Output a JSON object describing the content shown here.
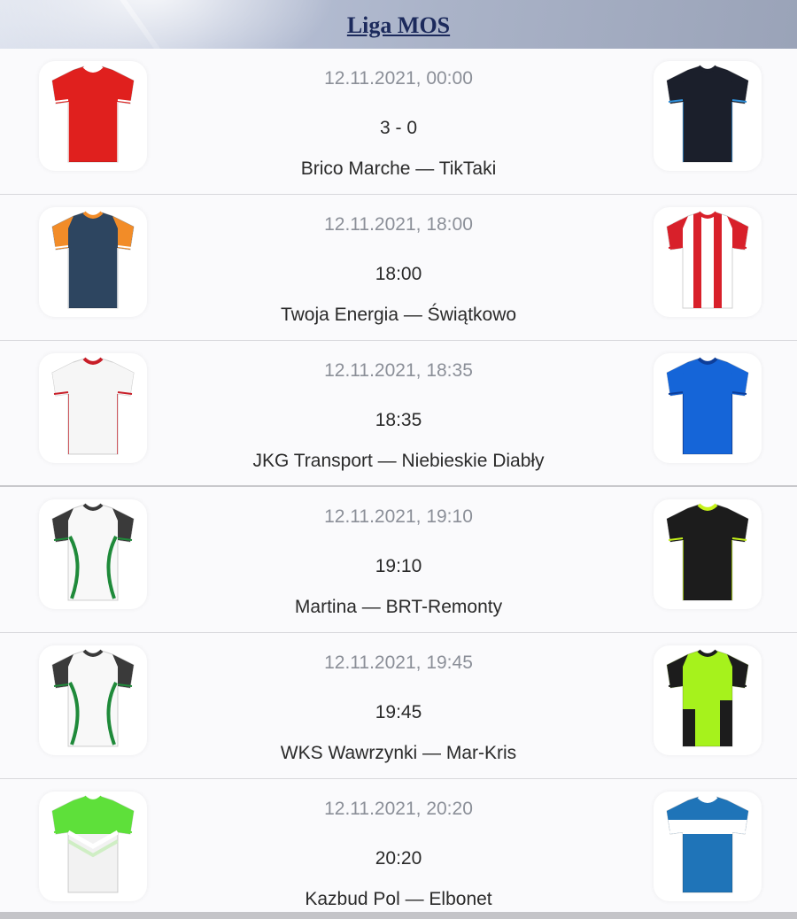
{
  "header": {
    "title": "Liga MOS"
  },
  "matches": [
    {
      "date": "12.11.2021, 00:00",
      "result": "3 - 0",
      "teams": "Brico Marche — TikTaki",
      "home_kit": {
        "type": "plain",
        "body": "#e0201e",
        "sleeve": "#e0201e",
        "collar": "#ffffff",
        "accent": "#ffffff"
      },
      "away_kit": {
        "type": "plain",
        "body": "#1b1f2b",
        "sleeve": "#1b1f2b",
        "collar": "#1b1f2b",
        "accent": "#2f8fd8"
      }
    },
    {
      "date": "12.11.2021, 18:00",
      "result": "18:00",
      "teams": "Twoja Energia — Świątkowo",
      "home_kit": {
        "type": "plain",
        "body": "#2d4560",
        "sleeve": "#f28c28",
        "collar": "#f28c28",
        "accent": "#ffffff"
      },
      "away_kit": {
        "type": "stripes",
        "body": "#ffffff",
        "sleeve": "#d8202a",
        "collar": "#d8202a",
        "accent": "#d8202a"
      }
    },
    {
      "date": "12.11.2021, 18:35",
      "result": "18:35",
      "teams": "JKG Transport — Niebieskie Diabły",
      "home_kit": {
        "type": "plain",
        "body": "#f6f6f6",
        "sleeve": "#f6f6f6",
        "collar": "#c81e28",
        "accent": "#c81e28"
      },
      "away_kit": {
        "type": "plain",
        "body": "#1565d8",
        "sleeve": "#1565d8",
        "collar": "#0d3e9a",
        "accent": "#0d3e9a"
      }
    },
    {
      "date": "12.11.2021, 19:10",
      "result": "19:10",
      "teams": "Martina — BRT-Remonty",
      "home_kit": {
        "type": "curves",
        "body": "#f8f8f8",
        "sleeve": "#3a3a3a",
        "collar": "#3a3a3a",
        "accent": "#1f8a3a"
      },
      "away_kit": {
        "type": "plain",
        "body": "#1c1c1c",
        "sleeve": "#1c1c1c",
        "collar": "#c6f21a",
        "accent": "#c6f21a"
      }
    },
    {
      "date": "12.11.2021, 19:45",
      "result": "19:45",
      "teams": "WKS Wawrzynki — Mar-Kris",
      "home_kit": {
        "type": "curves",
        "body": "#f8f8f8",
        "sleeve": "#3a3a3a",
        "collar": "#3a3a3a",
        "accent": "#1f8a3a"
      },
      "away_kit": {
        "type": "neonsplit",
        "body": "#a6f21c",
        "sleeve": "#1c1c1c",
        "collar": "#1c1c1c",
        "accent": "#1c1c1c"
      }
    },
    {
      "date": "12.11.2021, 20:20",
      "result": "20:20",
      "teams": "Kazbud Pol — Elbonet",
      "home_kit": {
        "type": "chevron",
        "body": "#f2f2f2",
        "sleeve": "#5ee03a",
        "collar": "#5ee03a",
        "accent": "#5ee03a"
      },
      "away_kit": {
        "type": "band",
        "body": "#1f74b8",
        "sleeve": "#1f74b8",
        "collar": "#ffffff",
        "accent": "#ffffff"
      }
    }
  ]
}
